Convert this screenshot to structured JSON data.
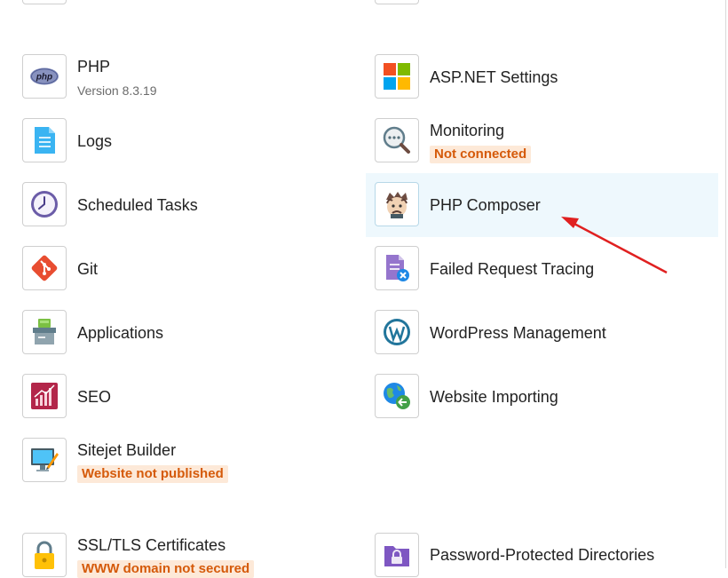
{
  "tools": {
    "php": {
      "label": "PHP",
      "sub": "Version 8.3.19"
    },
    "asp": {
      "label": "ASP.NET Settings"
    },
    "logs": {
      "label": "Logs"
    },
    "monitoring": {
      "label": "Monitoring",
      "badge": "Not connected"
    },
    "scheduled": {
      "label": "Scheduled Tasks"
    },
    "composer": {
      "label": "PHP Composer"
    },
    "git": {
      "label": "Git"
    },
    "failed": {
      "label": "Failed Request Tracing"
    },
    "applications": {
      "label": "Applications"
    },
    "wordpress": {
      "label": "WordPress Management"
    },
    "seo": {
      "label": "SEO"
    },
    "importing": {
      "label": "Website Importing"
    },
    "sitejet": {
      "label": "Sitejet Builder",
      "badge": "Website not published"
    },
    "ssl": {
      "label": "SSL/TLS Certificates",
      "badge": "WWW domain not secured"
    },
    "password": {
      "label": "Password-Protected Directories"
    }
  },
  "icons": {
    "php": "php-logo-icon",
    "asp": "windows-logo-icon",
    "logs": "document-icon",
    "monitoring": "magnifier-icon",
    "scheduled": "clock-icon",
    "composer": "composer-logo-icon",
    "git": "git-logo-icon",
    "failed": "failed-request-icon",
    "applications": "applications-box-icon",
    "wordpress": "wordpress-logo-icon",
    "seo": "seo-chart-icon",
    "importing": "globe-import-icon",
    "sitejet": "monitor-pen-icon",
    "ssl": "padlock-icon",
    "password": "folder-lock-icon"
  },
  "colors": {
    "badge_text": "#d55a0a",
    "badge_bg": "#fde9d8",
    "highlight_bg": "#eef8fd",
    "annotation_arrow": "#e02020"
  }
}
